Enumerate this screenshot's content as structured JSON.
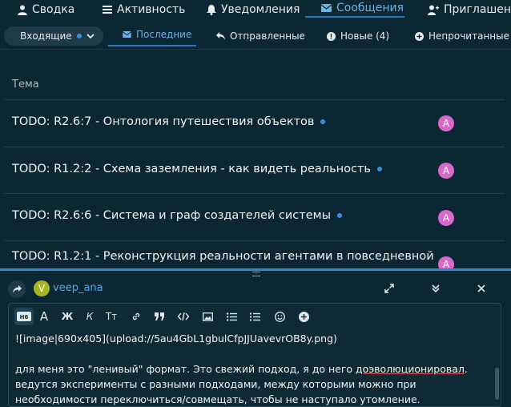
{
  "top_nav": [
    {
      "label": "Сводка",
      "icon": "user-icon"
    },
    {
      "label": "Активность",
      "icon": "list-icon"
    },
    {
      "label": "Уведомления",
      "icon": "bell-icon"
    },
    {
      "label": "Сообщения",
      "icon": "envelope-icon",
      "active": true
    },
    {
      "label": "Приглашения",
      "icon": "user-plus-icon"
    }
  ],
  "sub_nav": {
    "inbox_label": "Входящие",
    "items": [
      {
        "label": "Последние",
        "icon": "envelope-icon",
        "active": true
      },
      {
        "label": "Отправленные",
        "icon": "reply-icon"
      },
      {
        "label": "Новые (4)",
        "icon": "exclamation-icon"
      },
      {
        "label": "Непрочитанные",
        "icon": "plus-circle-icon"
      }
    ]
  },
  "list": {
    "column_header": "Тема",
    "topics": [
      {
        "title": "TODO: R2.6:7 - Онтология путешествия объектов",
        "avatar": "A"
      },
      {
        "title": "TODO: R1.2:2 - Схема заземления - как видеть реальность",
        "avatar": "A"
      },
      {
        "title": "TODO: R2.6:6 - Система и граф создателей системы",
        "avatar": "A"
      },
      {
        "title": "TODO: R1.2:1 - Реконструкция реальности агентами в повседневной",
        "avatar": "A"
      }
    ]
  },
  "composer": {
    "user_initial": "V",
    "username": "veep_ana",
    "toolbar": [
      "H6",
      "A",
      "Ж",
      "К",
      "Tт",
      "link",
      "quote",
      "code",
      "image",
      "bullets",
      "numbers",
      "emoji",
      "add"
    ],
    "text_line1": "![image|690x405](upload://5au4GbL1gbulCfpJJUavevrOB8y.png)",
    "text_para_before": "для меня это \"ленивый\" формат. Это свежий подход, я до него ",
    "text_underlined": "доэволюционировал",
    "text_para_after": ". ведутся эксперименты с разными подходами, между которыми можно при необходимости переключиться/совмещать, чтобы не наступало утомление."
  }
}
